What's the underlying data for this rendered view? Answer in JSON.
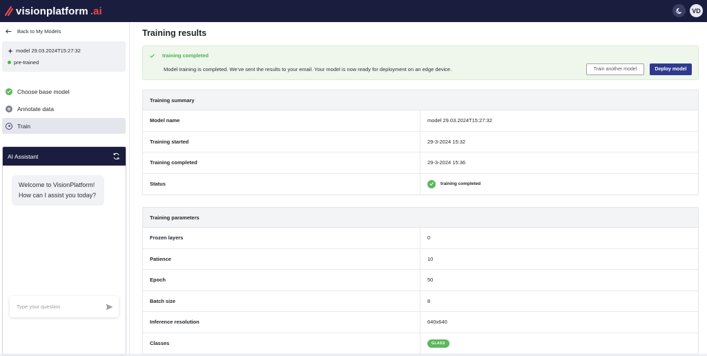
{
  "app": {
    "logo_text": "visionplatform",
    "logo_suffix": ".ai",
    "avatar_initials": "VD",
    "theme_icon": "moon-icon"
  },
  "sidebar": {
    "back_label": "Back to My Models",
    "model_name": "model 29.03.2024T15:27:32",
    "model_status": "pre-trained",
    "steps": [
      {
        "label": "Choose base model",
        "icon": "check-circle-icon",
        "state": "done"
      },
      {
        "label": "Annotate data",
        "icon": "gear-icon",
        "state": "pending"
      },
      {
        "label": "Train",
        "icon": "gear-icon",
        "state": "active"
      }
    ]
  },
  "assistant": {
    "title": "AI Assistant",
    "greeting_line1": "Welcome to VisionPlatform!",
    "greeting_line2": "How can I assist you today?",
    "input_placeholder": "Type your question"
  },
  "main": {
    "title": "Training results",
    "alert": {
      "title": "training completed",
      "message": "Model training is completed. We’ve sent the results to your email. Your model is now ready for deployment on an edge device.",
      "secondary_button": "Train another model",
      "primary_button": "Deploy model"
    },
    "summary": {
      "heading": "Training summary",
      "rows": [
        {
          "key": "Model name",
          "value": "model 29.03.2024T15:27:32"
        },
        {
          "key": "Training started",
          "value": "29-3-2024 15:32"
        },
        {
          "key": "Training completed",
          "value": "29-3-2024 15:36"
        },
        {
          "key": "Status",
          "value": "training completed"
        }
      ]
    },
    "params": {
      "heading": "Training parameters",
      "rows": [
        {
          "key": "Frozen layers",
          "value": "0"
        },
        {
          "key": "Patience",
          "value": "10"
        },
        {
          "key": "Epoch",
          "value": "50"
        },
        {
          "key": "Batch size",
          "value": "8"
        },
        {
          "key": "Inference resolution",
          "value": "640x640"
        },
        {
          "key": "Classes",
          "value": "GLASS"
        }
      ]
    }
  },
  "colors": {
    "nav_bg": "#1b1d3f",
    "success": "#4caf50",
    "primary": "#2f3a8f",
    "logo_accent": "#e44b4b"
  }
}
